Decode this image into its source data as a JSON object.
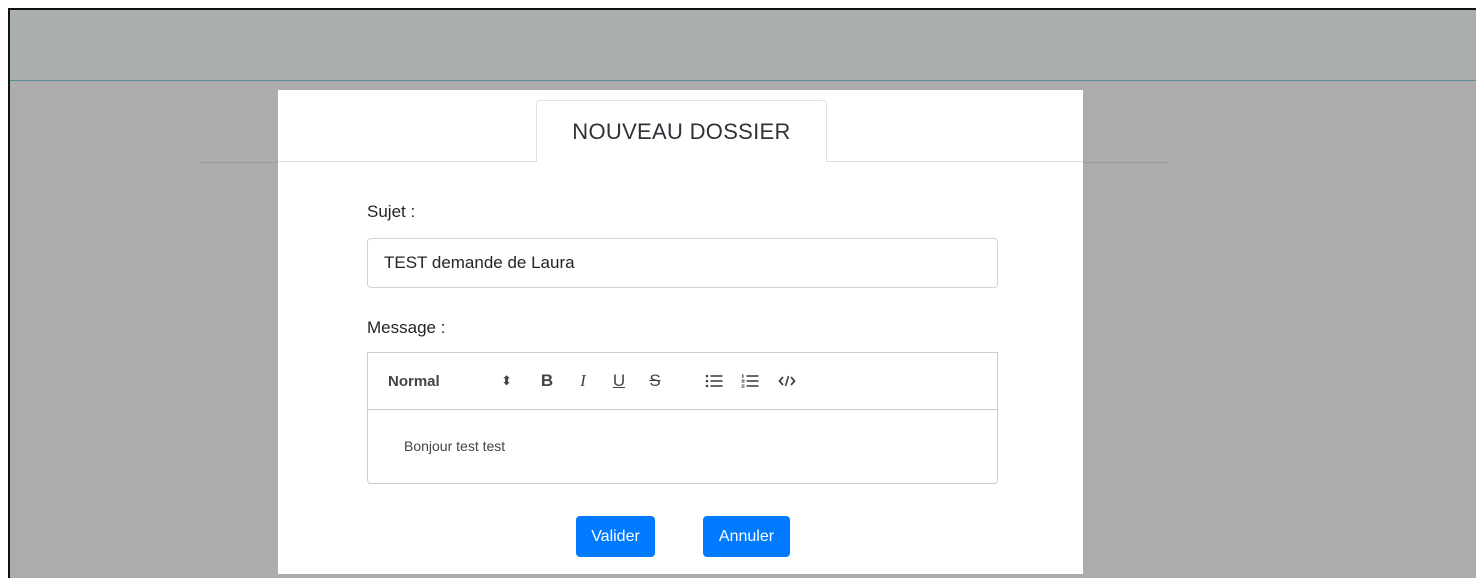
{
  "dialog": {
    "tab_title": "NOUVEAU DOSSIER",
    "subject_label": "Sujet :",
    "subject_value": "TEST demande de Laura",
    "message_label": "Message :",
    "message_text": "Bonjour test test"
  },
  "toolbar": {
    "format_label": "Normal",
    "format_arrows": "⬍",
    "bold": "B",
    "italic": "I",
    "underline": "U",
    "strike": "S"
  },
  "buttons": {
    "validate": "Valider",
    "cancel": "Annuler"
  },
  "colors": {
    "primary_button": "#007bff",
    "overlay": "#acacac",
    "topbar": "#a9aeae"
  }
}
